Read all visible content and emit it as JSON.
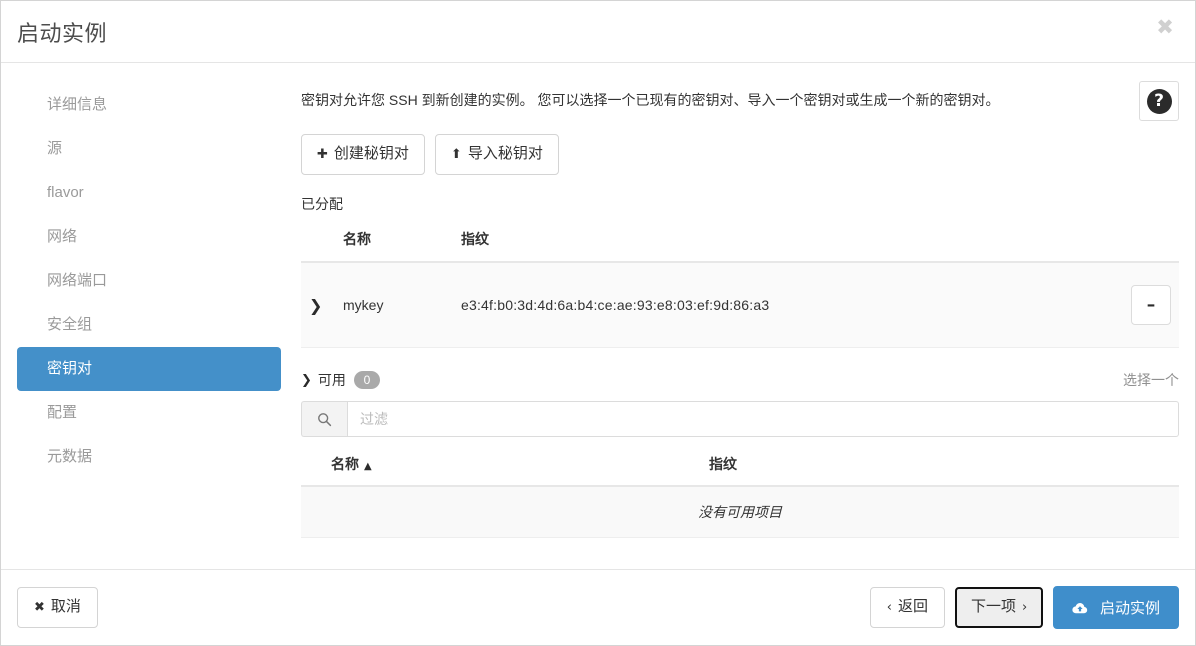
{
  "header": {
    "title": "启动实例",
    "close_icon": "close-icon",
    "close_glyph": "✖"
  },
  "sidebar": {
    "items": [
      {
        "label": "详细信息",
        "active": false
      },
      {
        "label": "源",
        "active": false
      },
      {
        "label": "flavor",
        "active": false
      },
      {
        "label": "网络",
        "active": false
      },
      {
        "label": "网络端口",
        "active": false
      },
      {
        "label": "安全组",
        "active": false
      },
      {
        "label": "密钥对",
        "active": true
      },
      {
        "label": "配置",
        "active": false
      },
      {
        "label": "元数据",
        "active": false
      }
    ]
  },
  "main": {
    "description": "密钥对允许您 SSH 到新创建的实例。 您可以选择一个已现有的密钥对、导入一个密钥对或生成一个新的密钥对。",
    "help_icon": "help-icon",
    "help_glyph": "?",
    "actions": {
      "create_label": "创建秘钥对",
      "create_icon": "plus-icon",
      "create_glyph": "✚",
      "import_label": "导入秘钥对",
      "import_icon": "upload-icon",
      "import_glyph": "⬆"
    },
    "allocated": {
      "section_label": "已分配",
      "columns": [
        "名称",
        "指纹"
      ],
      "rows": [
        {
          "expand_icon": "chevron-right-icon",
          "expand_glyph": "❯",
          "name": "mykey",
          "fingerprint": "e3:4f:b0:3d:4d:6a:b4:ce:ae:93:e8:03:ef:9d:86:a3",
          "remove_icon": "minus-icon",
          "remove_glyph": "▬"
        }
      ]
    },
    "available": {
      "toggle_icon": "chevron-down-icon",
      "toggle_glyph": "❮",
      "label": "可用",
      "count": "0",
      "hint": "选择一个",
      "filter": {
        "icon": "search-icon",
        "value": "",
        "placeholder": "过滤"
      },
      "columns": [
        "名称",
        "指纹"
      ],
      "sort_icon": "sort-ascending-icon",
      "sort_glyph": "▲",
      "empty_message": "没有可用项目"
    }
  },
  "footer": {
    "cancel_label": "取消",
    "cancel_icon": "x-icon",
    "cancel_glyph": "✖",
    "back_label": "返回",
    "back_icon": "chevron-left-icon",
    "back_glyph": "‹",
    "next_label": "下一项",
    "next_icon": "chevron-right-icon",
    "next_glyph": "›",
    "launch_label": "启动实例",
    "launch_icon": "cloud-upload-icon"
  },
  "colors": {
    "accent": "#4490c9",
    "primary_button": "#3f8ecb",
    "badge": "#a9a9a9",
    "muted_text": "#9a9a9a"
  }
}
